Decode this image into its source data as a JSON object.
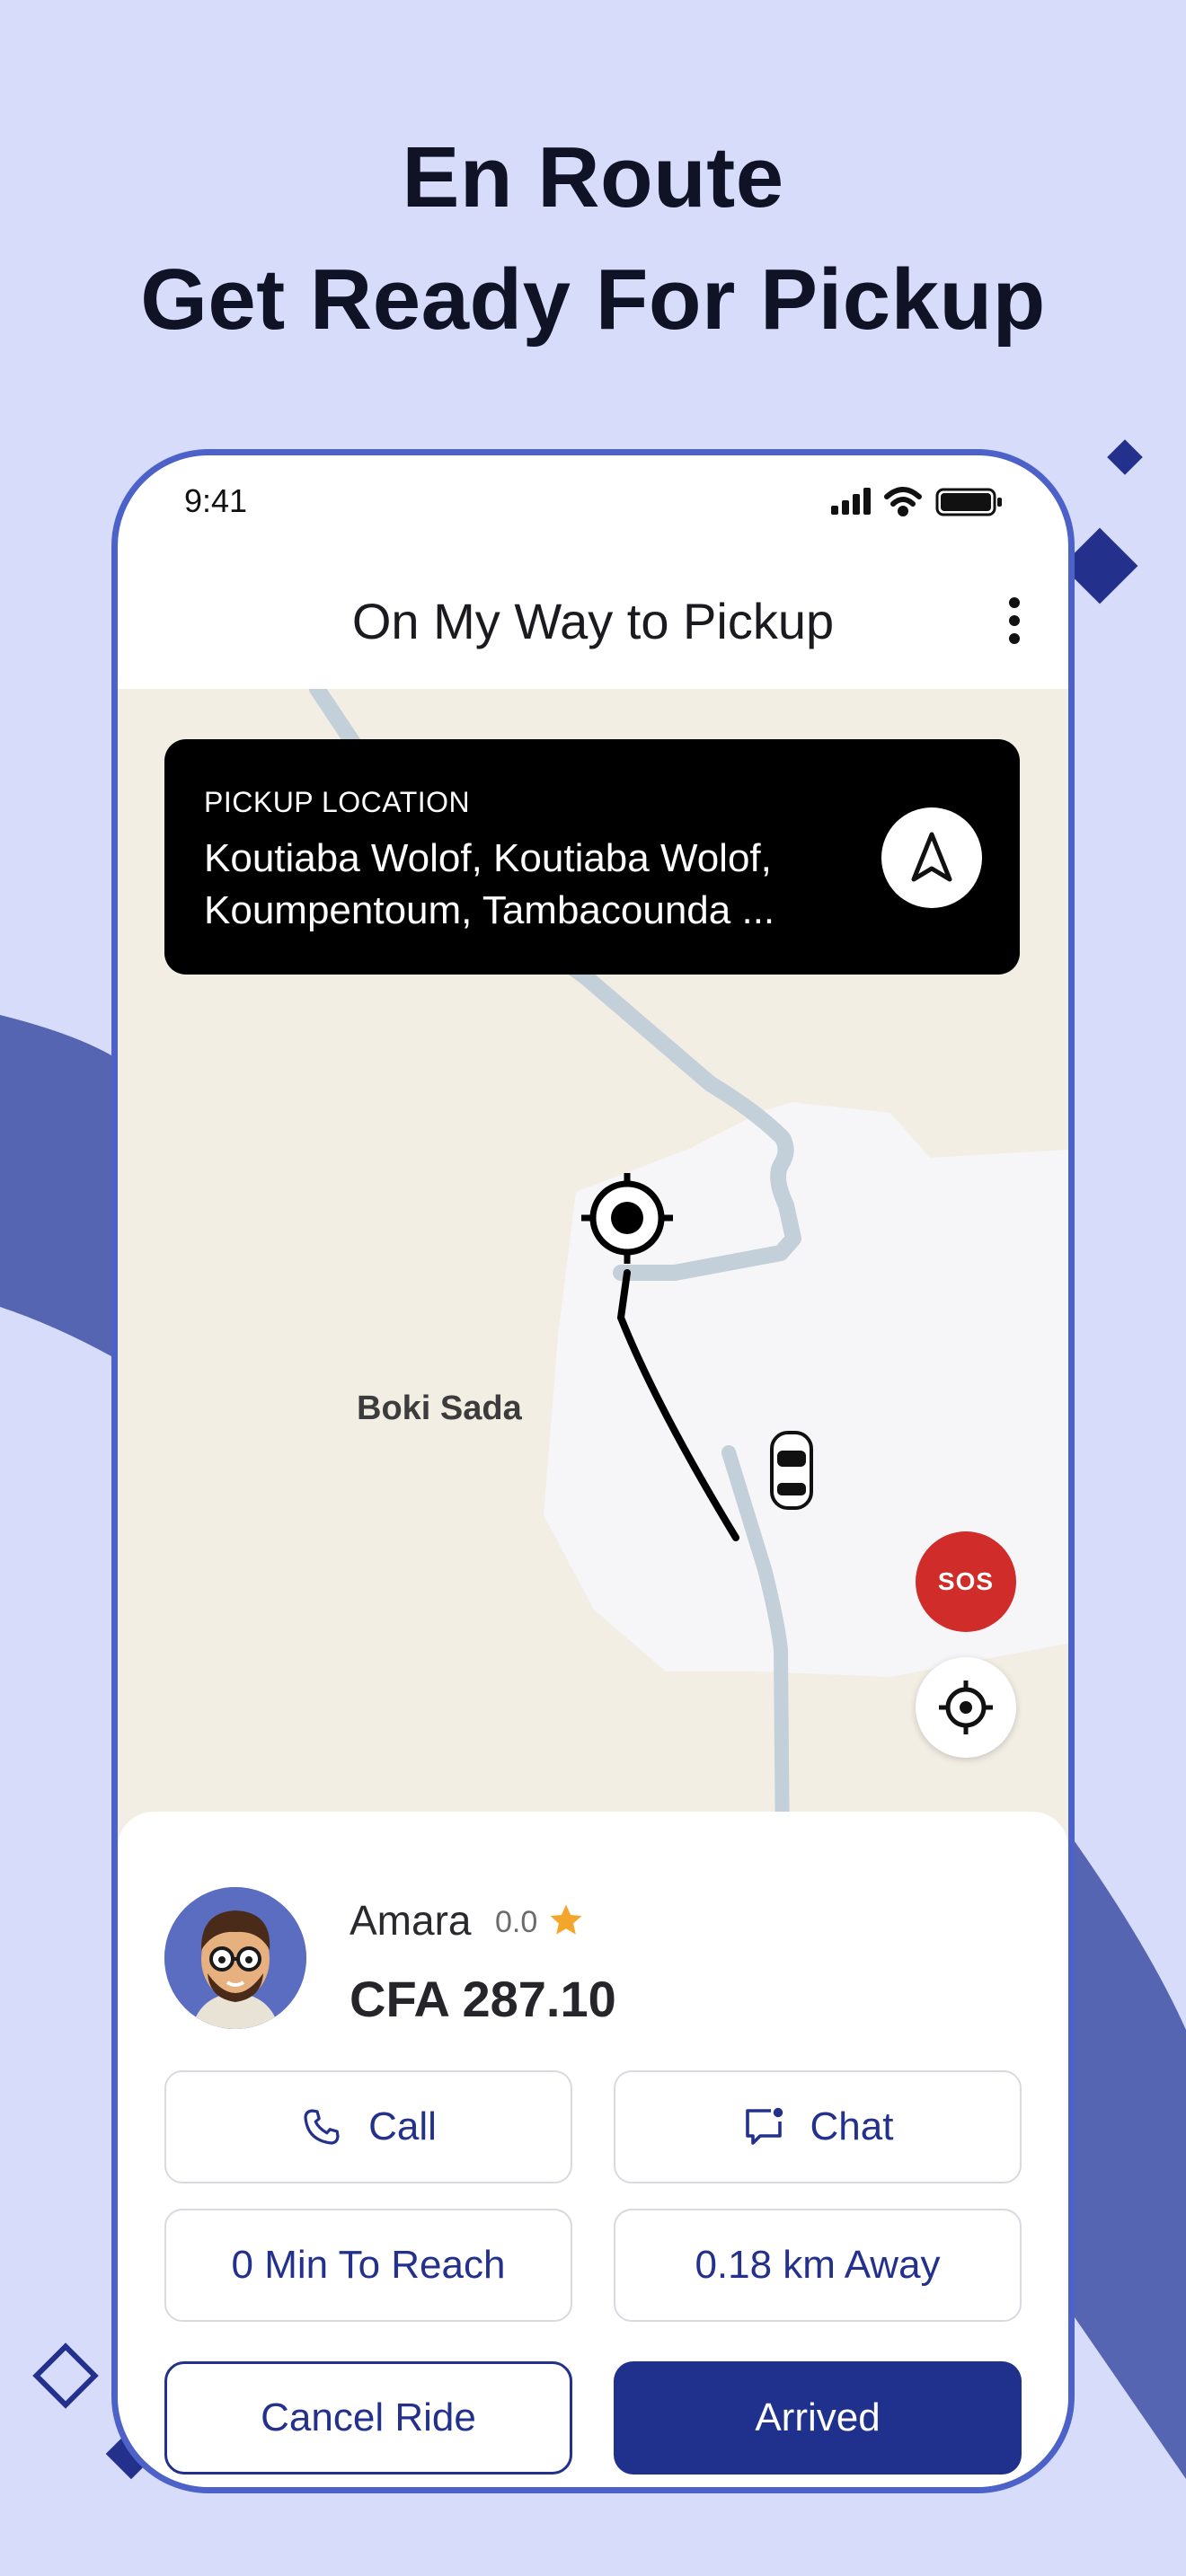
{
  "headline": {
    "line1": "En Route",
    "line2": "Get Ready For Pickup"
  },
  "status_bar": {
    "time": "9:41"
  },
  "header": {
    "title": "On My Way to Pickup"
  },
  "pickup": {
    "label": "PICKUP LOCATION",
    "address": "Koutiaba Wolof, Koutiaba Wolof, Koumpentoum, Tambacounda ..."
  },
  "map": {
    "place_label": "Boki Sada"
  },
  "sos": {
    "label": "SOS"
  },
  "driver": {
    "name": "Amara",
    "rating": "0.0",
    "fare": "CFA 287.10"
  },
  "actions": {
    "call": "Call",
    "chat": "Chat",
    "minutes_to_reach": "0 Min To Reach",
    "distance": "0.18 km Away",
    "cancel": "Cancel Ride",
    "arrived": "Arrived"
  },
  "colors": {
    "background": "#d6dcfa",
    "accent": "#1f318d",
    "frame": "#4d62c8",
    "sos": "#cf2c2a",
    "star": "#f4a62a"
  },
  "icons": {
    "navigate": "navigation-arrow-icon",
    "menu": "more-vertical-icon",
    "call": "phone-icon",
    "chat": "chat-bubble-icon",
    "locate": "crosshair-icon",
    "rating": "star-icon"
  }
}
